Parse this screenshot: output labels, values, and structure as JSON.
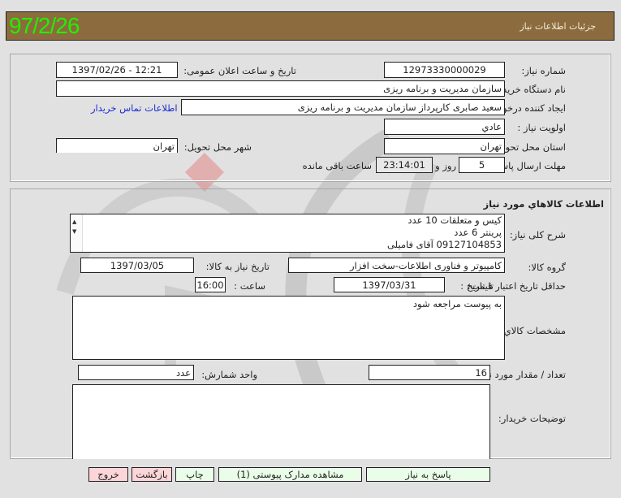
{
  "header": {
    "date_badge": "97/2/26",
    "title": "جزئیات اطلاعات نیاز",
    "bg_color": "#8c6c3e",
    "date_color": "#22f000"
  },
  "general": {
    "need_number_label": "شماره نیاز:",
    "need_number": "12973330000029",
    "announce_label": "تاریخ و ساعت اعلان عمومی:",
    "announce_value": "1397/02/26 - 12:21",
    "buyer_org_label": "نام دستگاه خریدار:",
    "buyer_org": "سازمان مدیریت و برنامه ریزی",
    "requester_label": "ایجاد کننده درخواست:",
    "requester": "سعید صابری کارپرداز سازمان مدیریت و برنامه ریزی",
    "contact_link": "اطلاعات تماس خریدار",
    "priority_label": "اولویت نیاز :",
    "priority": "عادي",
    "province_label": "استان محل تحویل:",
    "province": "تهران",
    "city_label": "شهر محل تحویل:",
    "city": "تهران",
    "deadline_label": "مهلت ارسال پاسخ:",
    "deadline_days": "5",
    "days_word": "روز و",
    "deadline_time": "23:14:01",
    "remaining_word": "ساعت باقی مانده"
  },
  "goods": {
    "section_title": "اطلاعات کالاهاي مورد نیاز",
    "desc_label": "شرح کلی نیاز:",
    "desc_lines": [
      "کیس و متعلقات 10 عدد",
      "پرینتر 6 عدد",
      "09127104853 آقای فامیلی"
    ],
    "group_label": "گروه کالا:",
    "group": "کامپیوتر و فناوری اطلاعات-سخت افزار",
    "need_date_label": "تاریخ نیاز به کالا:",
    "need_date": "1397/03/05",
    "min_validity_label": "حداقل تاریخ اعتبار قیمت:",
    "until_date_label": "تا تاریخ :",
    "until_date": "1397/03/31",
    "time_label": "ساعت :",
    "time": "16:00",
    "specs_label": "مشخصات کالاي مورد نیاز:",
    "specs": "به پیوست مراجعه شود",
    "qty_label": "تعداد / مقدار مورد نیاز:",
    "qty": "16",
    "unit_label": "واحد شمارش:",
    "unit": "عدد",
    "buyer_notes_label": "توضیحات خریدار:",
    "buyer_notes": ""
  },
  "buttons": {
    "respond": "پاسخ به نیاز",
    "attachments": "مشاهده مدارک پیوستی (1)",
    "print": "چاپ",
    "back": "بازگشت",
    "exit": "خروج"
  }
}
